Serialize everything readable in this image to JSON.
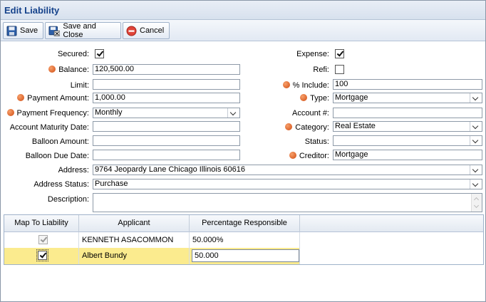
{
  "window": {
    "title": "Edit Liability"
  },
  "toolbar": {
    "save": "Save",
    "save_close": "Save and Close",
    "cancel": "Cancel"
  },
  "colors": {
    "required": "#d04b10",
    "title": "#15428b",
    "selected_row": "#fbeb8e"
  },
  "form": {
    "secured": {
      "label": "Secured:",
      "checked": true
    },
    "expense": {
      "label": "Expense:",
      "checked": true
    },
    "balance": {
      "label": "Balance:",
      "value": "120,500.00"
    },
    "refi": {
      "label": "Refi:",
      "checked": false
    },
    "limit": {
      "label": "Limit:",
      "value": ""
    },
    "pct_include": {
      "label": "% Include:",
      "value": "100"
    },
    "payment_amount": {
      "label": "Payment Amount:",
      "value": "1,000.00"
    },
    "type": {
      "label": "Type:",
      "value": "Mortgage"
    },
    "payment_frequency": {
      "label": "Payment Frequency:",
      "value": "Monthly"
    },
    "account_no": {
      "label": "Account #:",
      "value": ""
    },
    "maturity_date": {
      "label": "Account Maturity Date:",
      "value": ""
    },
    "category": {
      "label": "Category:",
      "value": "Real Estate"
    },
    "balloon_amount": {
      "label": "Balloon Amount:",
      "value": ""
    },
    "status": {
      "label": "Status:",
      "value": ""
    },
    "balloon_due": {
      "label": "Balloon Due Date:",
      "value": ""
    },
    "creditor": {
      "label": "Creditor:",
      "value": "Mortgage"
    },
    "address": {
      "label": "Address:",
      "value": "9764 Jeopardy Lane Chicago Illinois 60616"
    },
    "address_status": {
      "label": "Address Status:",
      "value": "Purchase"
    },
    "description": {
      "label": "Description:",
      "value": ""
    }
  },
  "grid": {
    "headers": [
      "Map To Liability",
      "Applicant",
      "Percentage Responsible"
    ],
    "rows": [
      {
        "mapped": true,
        "applicant": "KENNETH ASACOMMON",
        "pct": "50.000%"
      },
      {
        "mapped": true,
        "applicant": "Albert Bundy",
        "pct": "50.000"
      }
    ]
  }
}
